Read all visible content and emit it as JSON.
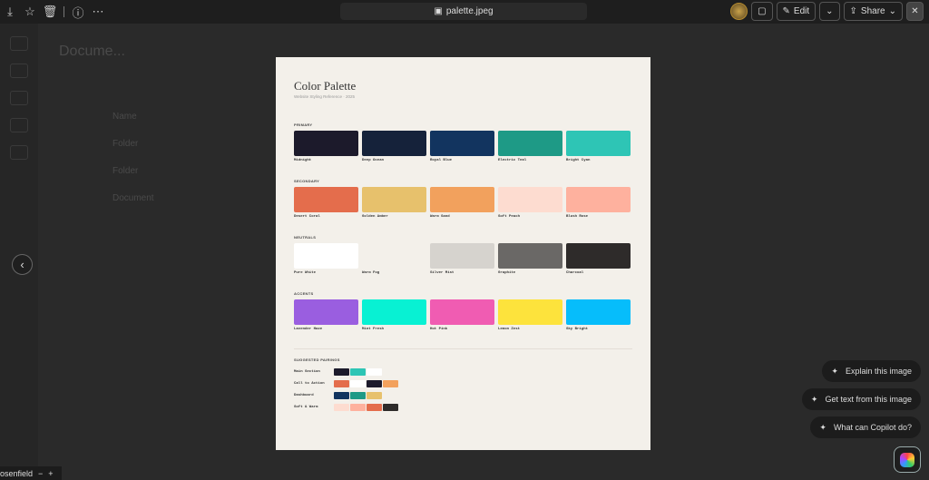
{
  "toolbar": {
    "filename": "palette.jpeg",
    "edit": "Edit",
    "share": "Share"
  },
  "background": {
    "title": "Docume...",
    "rows": [
      "Name",
      "Folder",
      "Folder",
      "Document"
    ]
  },
  "image": {
    "title": "Color Palette",
    "subtitle": "Website Styling Reference · 2025",
    "sections": [
      {
        "name": "PRIMARY",
        "swatches": [
          {
            "name": "Midnight",
            "color": "#1c1a2b"
          },
          {
            "name": "Deep Ocean",
            "color": "#15223a"
          },
          {
            "name": "Royal Blue",
            "color": "#12345f"
          },
          {
            "name": "Electric Teal",
            "color": "#1e9a86"
          },
          {
            "name": "Bright Cyan",
            "color": "#2ec5b5"
          }
        ]
      },
      {
        "name": "SECONDARY",
        "swatches": [
          {
            "name": "Desert Coral",
            "color": "#e46d4c"
          },
          {
            "name": "Golden Amber",
            "color": "#e7c16c"
          },
          {
            "name": "Warm Sand",
            "color": "#f2a15d"
          },
          {
            "name": "Soft Peach",
            "color": "#fddcd0"
          },
          {
            "name": "Blush Rose",
            "color": "#feb19e"
          }
        ]
      },
      {
        "name": "NEUTRALS",
        "swatches": [
          {
            "name": "Pure White",
            "color": "#ffffff"
          },
          {
            "name": "Warm Fog",
            "color": "#f3f0ea"
          },
          {
            "name": "Silver Mist",
            "color": "#d6d3ce"
          },
          {
            "name": "Graphite",
            "color": "#6a6866"
          },
          {
            "name": "Charcoal",
            "color": "#2e2b2a"
          }
        ]
      },
      {
        "name": "ACCENTS",
        "swatches": [
          {
            "name": "Lavender Haze",
            "color": "#9a5ee0"
          },
          {
            "name": "Mint Fresh",
            "color": "#08f1d3"
          },
          {
            "name": "Hot Pink",
            "color": "#f05cb2"
          },
          {
            "name": "Lemon Zest",
            "color": "#fde33c"
          },
          {
            "name": "Sky Bright",
            "color": "#06bdfb"
          }
        ]
      }
    ],
    "pairings_title": "SUGGESTED PAIRINGS",
    "pairings": [
      {
        "name": "Main Section",
        "colors": [
          "#1c1a2b",
          "#2ec5b5",
          "#ffffff"
        ]
      },
      {
        "name": "Call to Action",
        "colors": [
          "#e46d4c",
          "#ffffff",
          "#1c1a2b",
          "#f2a15d"
        ]
      },
      {
        "name": "Dashboard",
        "colors": [
          "#12345f",
          "#1e9a86",
          "#e7c16c"
        ]
      },
      {
        "name": "Soft & Warm",
        "colors": [
          "#fddcd0",
          "#feb19e",
          "#e46d4c",
          "#2e2b2a"
        ]
      }
    ]
  },
  "copilot": {
    "explain": "Explain this image",
    "get_text": "Get text from this image",
    "what_can": "What can Copilot do?"
  },
  "bottom": {
    "user": "osenfield"
  }
}
